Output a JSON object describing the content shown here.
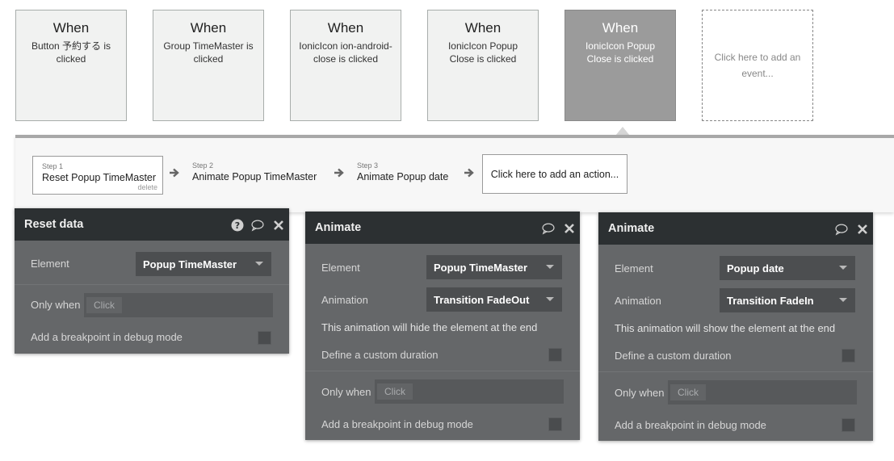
{
  "events": [
    {
      "when": "When",
      "desc": "Button 予約する is clicked"
    },
    {
      "when": "When",
      "desc": "Group TimeMaster is clicked"
    },
    {
      "when": "When",
      "desc": "IonicIcon ion-android-close is clicked"
    },
    {
      "when": "When",
      "desc": "IonicIcon Popup Close is clicked"
    },
    {
      "when": "When",
      "desc": "IonicIcon Popup Close is clicked"
    }
  ],
  "add_event": "Click here to add an event...",
  "steps": [
    {
      "num": "Step 1",
      "title": "Reset Popup TimeMaster",
      "delete": "delete"
    },
    {
      "num": "Step 2",
      "title": "Animate Popup TimeMaster"
    },
    {
      "num": "Step 3",
      "title": "Animate Popup date"
    }
  ],
  "add_action": "Click here to add an action...",
  "panels": {
    "reset": {
      "title": "Reset data",
      "element_label": "Element",
      "element_value": "Popup TimeMaster",
      "only_when_label": "Only when",
      "only_when_value": "Click",
      "breakpoint_label": "Add a breakpoint in debug mode"
    },
    "animate1": {
      "title": "Animate",
      "element_label": "Element",
      "element_value": "Popup TimeMaster",
      "animation_label": "Animation",
      "animation_value": "Transition FadeOut",
      "note": "This animation will hide the element at the end",
      "duration_label": "Define a custom duration",
      "only_when_label": "Only when",
      "only_when_value": "Click",
      "breakpoint_label": "Add a breakpoint in debug mode"
    },
    "animate2": {
      "title": "Animate",
      "element_label": "Element",
      "element_value": "Popup date",
      "animation_label": "Animation",
      "animation_value": "Transition FadeIn",
      "note": "This animation will show the element at the end",
      "duration_label": "Define a custom duration",
      "only_when_label": "Only when",
      "only_when_value": "Click",
      "breakpoint_label": "Add a breakpoint in debug mode"
    }
  },
  "colors": {
    "panel_bg": "#656769",
    "panel_header": "#2c3032",
    "selected_event": "#9b9b9b"
  }
}
